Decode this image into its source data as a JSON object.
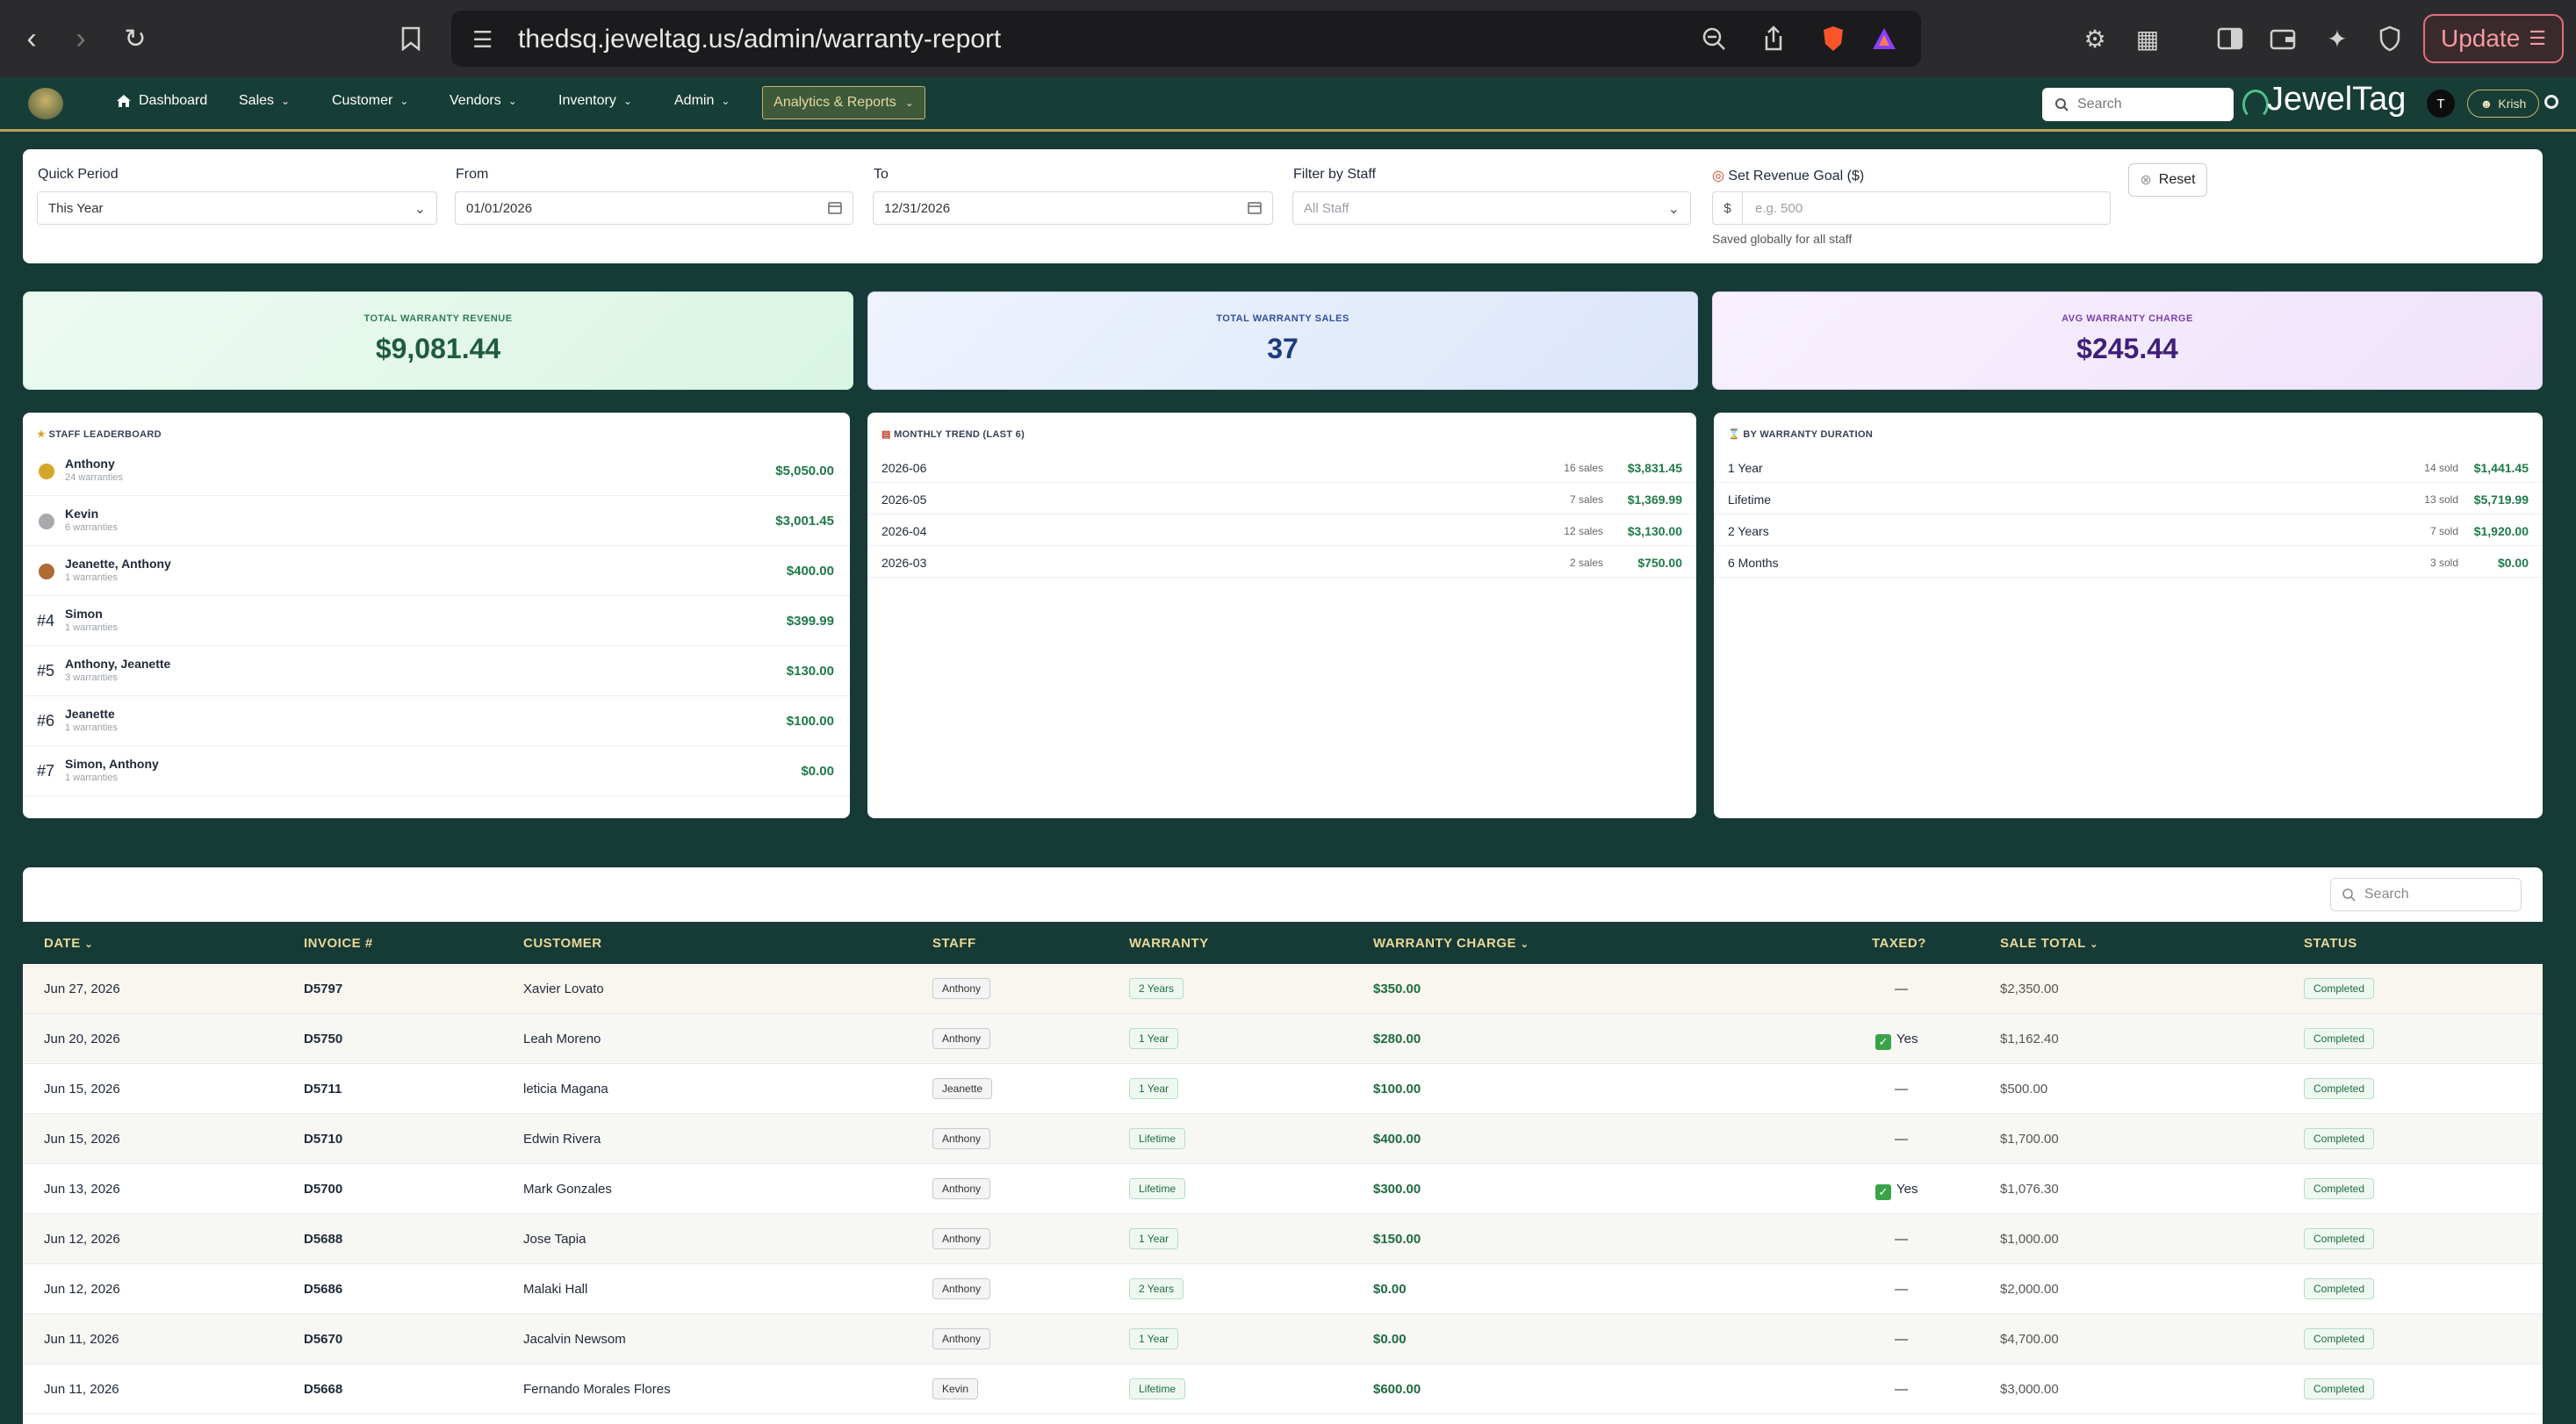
{
  "browser": {
    "url": "thedsq.jeweltag.us/admin/warranty-report",
    "update_label": "Update"
  },
  "nav": {
    "items": [
      {
        "label": "Dashboard"
      },
      {
        "label": "Sales"
      },
      {
        "label": "Customer"
      },
      {
        "label": "Vendors"
      },
      {
        "label": "Inventory"
      },
      {
        "label": "Admin"
      }
    ],
    "active": "Analytics & Reports",
    "search_placeholder": "Search",
    "brand": "JewelTag",
    "avatar_letter": "T",
    "user": "Krish"
  },
  "filters": {
    "quick_period_label": "Quick Period",
    "quick_period_value": "This Year",
    "from_label": "From",
    "from_value": "01/01/2026",
    "to_label": "To",
    "to_value": "12/31/2026",
    "staff_label": "Filter by Staff",
    "staff_value": "All Staff",
    "goal_label": "Set Revenue Goal ($)",
    "goal_prefix": "$",
    "goal_placeholder": "e.g. 500",
    "goal_hint": "Saved globally for all staff",
    "reset_label": "Reset"
  },
  "stats": {
    "revenue_label": "TOTAL WARRANTY REVENUE",
    "revenue_value": "$9,081.44",
    "sales_label": "TOTAL WARRANTY SALES",
    "sales_value": "37",
    "avg_label": "AVG WARRANTY CHARGE",
    "avg_value": "$245.44"
  },
  "leaderboard": {
    "title": "STAFF LEADERBOARD",
    "rows": [
      {
        "rank": "",
        "name": "Anthony",
        "sub": "24 warranties",
        "amount": "$5,050.00",
        "medal": "#d4a72c"
      },
      {
        "rank": "",
        "name": "Kevin",
        "sub": "6 warranties",
        "amount": "$3,001.45",
        "medal": "#a7a9ac"
      },
      {
        "rank": "",
        "name": "Jeanette, Anthony",
        "sub": "1 warranties",
        "amount": "$400.00",
        "medal": "#b06a34"
      },
      {
        "rank": "#4",
        "name": "Simon",
        "sub": "1 warranties",
        "amount": "$399.99",
        "medal": ""
      },
      {
        "rank": "#5",
        "name": "Anthony, Jeanette",
        "sub": "3 warranties",
        "amount": "$130.00",
        "medal": ""
      },
      {
        "rank": "#6",
        "name": "Jeanette",
        "sub": "1 warranties",
        "amount": "$100.00",
        "medal": ""
      },
      {
        "rank": "#7",
        "name": "Simon, Anthony",
        "sub": "1 warranties",
        "amount": "$0.00",
        "medal": ""
      }
    ]
  },
  "trend": {
    "title": "MONTHLY TREND (LAST 6)",
    "rows": [
      {
        "label": "2026-06",
        "count": "16 sales",
        "amount": "$3,831.45"
      },
      {
        "label": "2026-05",
        "count": "7 sales",
        "amount": "$1,369.99"
      },
      {
        "label": "2026-04",
        "count": "12 sales",
        "amount": "$3,130.00"
      },
      {
        "label": "2026-03",
        "count": "2 sales",
        "amount": "$750.00"
      }
    ]
  },
  "duration": {
    "title": "BY WARRANTY DURATION",
    "rows": [
      {
        "label": "1 Year",
        "count": "14 sold",
        "amount": "$1,441.45"
      },
      {
        "label": "Lifetime",
        "count": "13 sold",
        "amount": "$5,719.99"
      },
      {
        "label": "2 Years",
        "count": "7 sold",
        "amount": "$1,920.00"
      },
      {
        "label": "6 Months",
        "count": "3 sold",
        "amount": "$0.00"
      }
    ]
  },
  "table": {
    "search_placeholder": "Search",
    "headers": {
      "date": "DATE",
      "invoice": "INVOICE #",
      "customer": "CUSTOMER",
      "staff": "STAFF",
      "warranty": "WARRANTY",
      "charge": "WARRANTY CHARGE",
      "taxed": "TAXED?",
      "total": "SALE TOTAL",
      "status": "STATUS"
    },
    "rows": [
      {
        "date": "Jun 27, 2026",
        "invoice": "D5797",
        "customer": "Xavier Lovato",
        "staff": "Anthony",
        "warranty": "2 Years",
        "charge": "$350.00",
        "taxed": "—",
        "total": "$2,350.00",
        "status": "Completed"
      },
      {
        "date": "Jun 20, 2026",
        "invoice": "D5750",
        "customer": "Leah Moreno",
        "staff": "Anthony",
        "warranty": "1 Year",
        "charge": "$280.00",
        "taxed": "Yes",
        "total": "$1,162.40",
        "status": "Completed"
      },
      {
        "date": "Jun 15, 2026",
        "invoice": "D5711",
        "customer": "leticia Magana",
        "staff": "Jeanette",
        "warranty": "1 Year",
        "charge": "$100.00",
        "taxed": "—",
        "total": "$500.00",
        "status": "Completed"
      },
      {
        "date": "Jun 15, 2026",
        "invoice": "D5710",
        "customer": "Edwin Rivera",
        "staff": "Anthony",
        "warranty": "Lifetime",
        "charge": "$400.00",
        "taxed": "—",
        "total": "$1,700.00",
        "status": "Completed"
      },
      {
        "date": "Jun 13, 2026",
        "invoice": "D5700",
        "customer": "Mark Gonzales",
        "staff": "Anthony",
        "warranty": "Lifetime",
        "charge": "$300.00",
        "taxed": "Yes",
        "total": "$1,076.30",
        "status": "Completed"
      },
      {
        "date": "Jun 12, 2026",
        "invoice": "D5688",
        "customer": "Jose Tapia",
        "staff": "Anthony",
        "warranty": "1 Year",
        "charge": "$150.00",
        "taxed": "—",
        "total": "$1,000.00",
        "status": "Completed"
      },
      {
        "date": "Jun 12, 2026",
        "invoice": "D5686",
        "customer": "Malaki Hall",
        "staff": "Anthony",
        "warranty": "2 Years",
        "charge": "$0.00",
        "taxed": "—",
        "total": "$2,000.00",
        "status": "Completed"
      },
      {
        "date": "Jun 11, 2026",
        "invoice": "D5670",
        "customer": "Jacalvin Newsom",
        "staff": "Anthony",
        "warranty": "1 Year",
        "charge": "$0.00",
        "taxed": "—",
        "total": "$4,700.00",
        "status": "Completed"
      },
      {
        "date": "Jun 11, 2026",
        "invoice": "D5668",
        "customer": "Fernando Morales Flores",
        "staff": "Kevin",
        "warranty": "Lifetime",
        "charge": "$600.00",
        "taxed": "—",
        "total": "$3,000.00",
        "status": "Completed"
      }
    ]
  }
}
